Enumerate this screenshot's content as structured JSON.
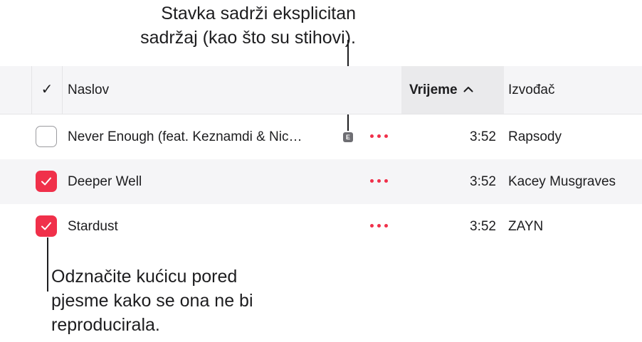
{
  "callouts": {
    "explicit_line1": "Stavka sadrži eksplicitan",
    "explicit_line2": "sadržaj (kao što su stihovi).",
    "checkbox_line1": "Odznačite kućicu pored",
    "checkbox_line2": "pjesme kako se ona ne bi",
    "checkbox_line3": "reproducirala."
  },
  "header": {
    "check": "✓",
    "title": "Naslov",
    "time": "Vrijeme",
    "time_sort_icon": "chevron-up-icon",
    "artist": "Izvođač"
  },
  "rows": [
    {
      "checked": false,
      "title": "Never Enough (feat. Keznamdi & Nic…",
      "explicit": "E",
      "time": "3:52",
      "artist": "Rapsody"
    },
    {
      "checked": true,
      "title": "Deeper Well",
      "time": "3:52",
      "artist": "Kacey Musgraves"
    },
    {
      "checked": true,
      "title": "Stardust",
      "time": "3:52",
      "artist": "ZAYN"
    }
  ],
  "colors": {
    "accent": "#f0304a",
    "header_bg": "#f5f5f7",
    "stripe": "#f5f5f7"
  }
}
